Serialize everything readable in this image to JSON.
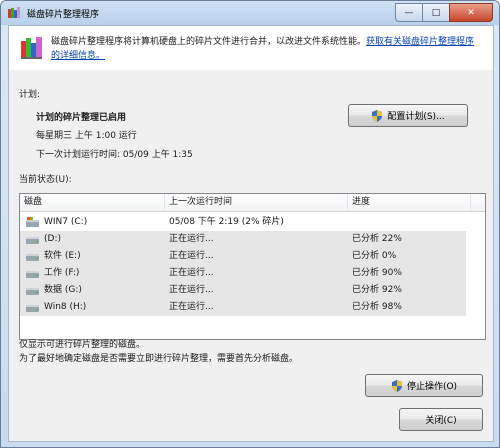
{
  "window": {
    "title": "磁盘碎片整理程序"
  },
  "description": {
    "text": "磁盘碎片整理程序将计算机硬盘上的碎片文件进行合并，以改进文件系统性能。",
    "link": "获取有关磁盘碎片整理程序的详细信息。"
  },
  "schedule": {
    "section_label": "计划:",
    "title": "计划的碎片整理已启用",
    "line1": "每星期三 上午 1:00 运行",
    "line2": "下一次计划运行时间: 05/09 上午 1:35",
    "button": "配置计划(S)..."
  },
  "status": {
    "section_label": "当前状态(U):",
    "columns": [
      "磁盘",
      "上一次运行时间",
      "进度"
    ],
    "rows": [
      {
        "disk": "WIN7 (C:)",
        "last_run": "05/08 下午 2:19 (2% 碎片)",
        "progress": ""
      },
      {
        "disk": "(D:)",
        "last_run": "正在运行...",
        "progress": "已分析 22%"
      },
      {
        "disk": "软件 (E:)",
        "last_run": "正在运行...",
        "progress": "已分析 0%"
      },
      {
        "disk": "工作 (F:)",
        "last_run": "正在运行...",
        "progress": "已分析 90%"
      },
      {
        "disk": "数据 (G:)",
        "last_run": "正在运行...",
        "progress": "已分析 92%"
      },
      {
        "disk": "Win8 (H:)",
        "last_run": "正在运行...",
        "progress": "已分析 98%"
      }
    ]
  },
  "footer": {
    "note1": "仅显示可进行碎片整理的磁盘。",
    "note2": "为了最好地确定磁盘是否需要立即进行碎片整理，需要首先分析磁盘。",
    "stop_button": "停止操作(O)",
    "close_button": "关闭(C)"
  },
  "caption_buttons": {
    "minimize": "—",
    "maximize": "□",
    "close": "✕"
  }
}
